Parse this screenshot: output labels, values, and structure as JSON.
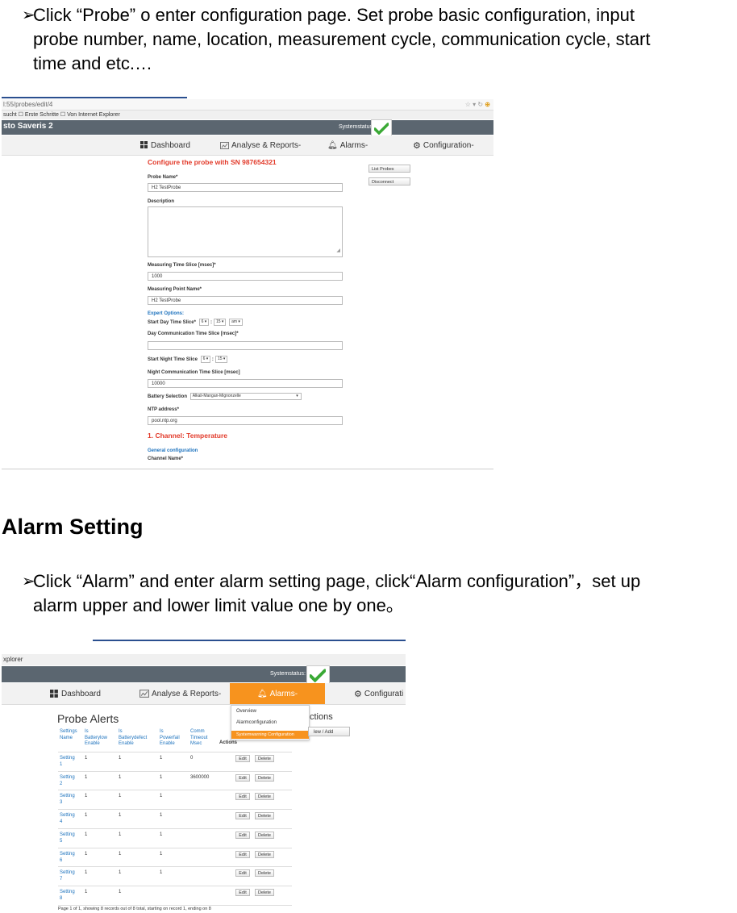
{
  "bullets": {
    "probe": [
      "Click “Probe” o enter configuration page.    Set probe basic configuration, input",
      "probe number, name, location, measurement cycle, communication cycle, start",
      "time and etc.…"
    ],
    "alarm": [
      "Click “Alarm” and enter alarm setting page, click“Alarm configuration”，set up",
      "alarm upper and lower limit value one by one。"
    ]
  },
  "section_title": "Alarm Setting",
  "shot1": {
    "url": "l:55/probes/edit/4",
    "bookmarks": "sucht ☐ Erste Schritte ☐ Von Internet Explorer",
    "brand": "sto Saveris 2",
    "status_label": "Systemstatus:",
    "nav": [
      "Dashboard",
      "Analyse & Reports-",
      "Alarms-",
      "Configuration-"
    ],
    "heading": "Configure the probe with SN 987654321",
    "fields": {
      "probe_name_label": "Probe Name*",
      "probe_name_value": "H2 TestProbe",
      "description_label": "Description",
      "time_slice_label": "Measuring Time Slice [msec]*",
      "time_slice_value": "1000",
      "point_name_label": "Measuring Point Name*",
      "point_name_value": "H2 TestProbe",
      "expert_options": "Expert Options:",
      "start_day_label": "Start Day Time Slice*",
      "start_day_h": "6",
      "start_day_m": "15",
      "start_day_ampm": "am",
      "day_comm_label": "Day Communication Time Slice [msec]*",
      "start_night_label": "Start Night Time Slice",
      "start_night_h": "6",
      "start_night_m": "15",
      "night_comm_label": "Night Communication Time Slice [msec]",
      "night_comm_value": "10000",
      "battery_label": "Battery Selection",
      "battery_value": "Alkali-Mangan-Mignonzelle",
      "ntp_label": "NTP address*",
      "ntp_value": "pool.ntp.org",
      "channel_heading": "1. Channel: Temperature",
      "general_config": "General configuration",
      "channel_name_label": "Channel Name*"
    },
    "side_buttons": [
      "List Probes",
      "Disconnect"
    ]
  },
  "shot2": {
    "bookmarks": "xplorer",
    "status_label": "Systemstatus:",
    "nav": [
      "Dashboard",
      "Analyse & Reports-",
      "Alarms-",
      "Configurati"
    ],
    "dropdown": [
      "Overview",
      "Alarmconfiguration",
      "Systemwarning Configuration"
    ],
    "title": "Probe Alerts",
    "actions_title": "ctions",
    "new_add": "lew / Add",
    "headers": [
      [
        "Settings",
        "Name"
      ],
      [
        "Is",
        "Batterylow",
        "Enable"
      ],
      [
        "Is",
        "Batterydefect",
        "Enable"
      ],
      [
        "Is",
        "Powerfail",
        "Enable"
      ],
      [
        "Comm",
        "Timeout",
        "Msec"
      ],
      [
        "Actions"
      ]
    ],
    "rows": [
      {
        "name": [
          "Setting",
          "1"
        ],
        "b1": "1",
        "b2": "1",
        "b3": "1",
        "t": "0"
      },
      {
        "name": [
          "Setting",
          "2"
        ],
        "b1": "1",
        "b2": "1",
        "b3": "1",
        "t": "3600000"
      },
      {
        "name": [
          "Setting",
          "3"
        ],
        "b1": "1",
        "b2": "1",
        "b3": "1",
        "t": ""
      },
      {
        "name": [
          "Setting",
          "4"
        ],
        "b1": "1",
        "b2": "1",
        "b3": "1",
        "t": ""
      },
      {
        "name": [
          "Setting",
          "5"
        ],
        "b1": "1",
        "b2": "1",
        "b3": "1",
        "t": ""
      },
      {
        "name": [
          "Setting",
          "6"
        ],
        "b1": "1",
        "b2": "1",
        "b3": "1",
        "t": ""
      },
      {
        "name": [
          "Setting",
          "7"
        ],
        "b1": "1",
        "b2": "1",
        "b3": "1",
        "t": ""
      },
      {
        "name": [
          "Setting",
          "8"
        ],
        "b1": "1",
        "b2": "1",
        "b3": "",
        "t": ""
      }
    ],
    "edit": "Edit",
    "delete": "Delete",
    "pager": "Page 1 of 1, showing 8 records out of 8 total, starting on record 1, ending on 8"
  },
  "colors": {
    "orange": "#f7931e",
    "red": "#e23a2a",
    "link": "#1e73be",
    "appbar": "#5b6670",
    "check": "#3aa935"
  }
}
